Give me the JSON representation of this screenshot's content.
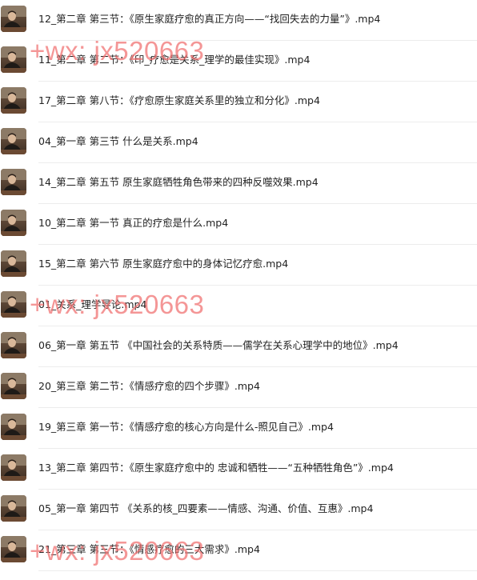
{
  "files": [
    {
      "name": "12_第二章 第三节：《原生家庭疗愈的真正方向——“找回失去的力量”》.mp4"
    },
    {
      "name": "11_第二章 第二节：《印_疗愈是关系_理学的最佳实现》.mp4"
    },
    {
      "name": "17_第二章 第八节：《疗愈原生家庭关系里的独立和分化》.mp4"
    },
    {
      "name": "04_第一章 第三节 什么是关系.mp4"
    },
    {
      "name": "14_第二章 第五节 原生家庭牺牲角色带来的四种反噬效果.mp4"
    },
    {
      "name": "10_第二章 第一节 真正的疗愈是什么.mp4"
    },
    {
      "name": "15_第二章 第六节 原生家庭疗愈中的身体记忆疗愈.mp4"
    },
    {
      "name": "01_关系_理学导论.mp4"
    },
    {
      "name": "06_第一章 第五节 《中国社会的关系特质——儒学在关系心理学中的地位》.mp4"
    },
    {
      "name": "20_第三章 第二节：《情感疗愈的四个步骤》.mp4"
    },
    {
      "name": "19_第三章 第一节：《情感疗愈的核心方向是什么-照见自己》.mp4"
    },
    {
      "name": "13_第二章 第四节：《原生家庭疗愈中的 忠诚和牺牲——“五种牺牲角色”》.mp4"
    },
    {
      "name": "05_第一章 第四节 《关系的核_四要素——情感、沟通、价值、互惠》.mp4"
    },
    {
      "name": "21_第三章 第三节：《情感疗愈的三大需求》.mp4"
    }
  ],
  "watermark": {
    "text": "+wx: jx520663",
    "color": "#f06e6e"
  },
  "thumbnail_icon": "video-thumbnail-icon"
}
